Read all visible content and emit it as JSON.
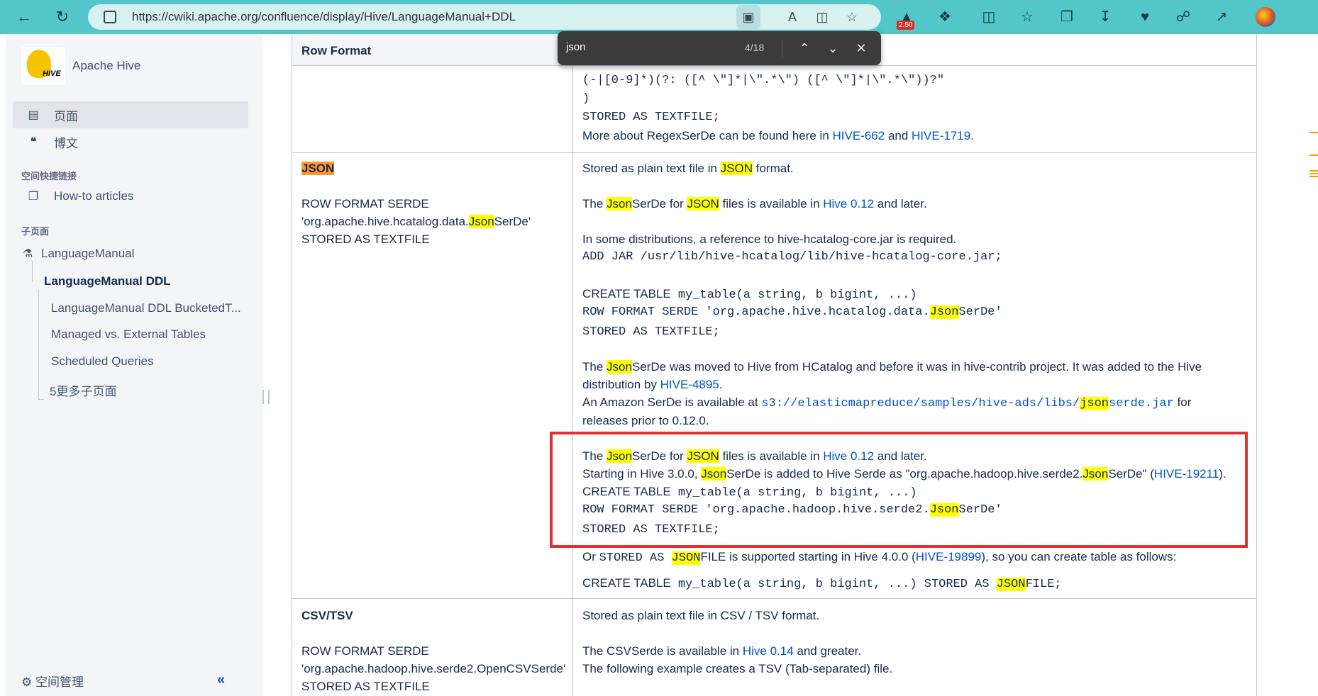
{
  "browser": {
    "url": "https://cwiki.apache.org/confluence/display/Hive/LanguageManual+DDL",
    "badge": "2.50",
    "find": {
      "query": "json",
      "count": "4/18"
    }
  },
  "sidebar": {
    "space_title": "Apache Hive",
    "logo_text": "HIVE",
    "items": [
      {
        "label": "页面",
        "icon": "page-icon"
      },
      {
        "label": "博文",
        "icon": "quote-icon"
      }
    ],
    "shortcuts_heading": "空间快捷链接",
    "shortcut": "How-to articles",
    "children_heading": "子页面",
    "tree": {
      "root": "LanguageManual",
      "current": "LanguageManual DDL",
      "children": [
        "LanguageManual DDL BucketedT...",
        "Managed vs. External Tables",
        "Scheduled Queries"
      ],
      "more": "5更多子页面"
    },
    "footer": "空间管理"
  },
  "table": {
    "header": "Row Format",
    "regex_row": {
      "code1": "(-|[0-9]*)(?: ([^ \\\"]*|\\\".*\\\") ([^ \\\"]*|\\\".*\\\"))?\"",
      "code2": ")",
      "code3": "STORED AS TEXTFILE;",
      "more_pre": "More about RegexSerDe can be found here in ",
      "link1": "HIVE-662",
      "and": " and ",
      "link2": "HIVE-1719",
      "end": "."
    },
    "json_row": {
      "label": "JSON",
      "serde1": "ROW FORMAT SERDE",
      "serde2_pre": "'org.apache.hive.hcatalog.data.",
      "serde2_hl": "Json",
      "serde2_post": "SerDe'",
      "serde3": "STORED AS TEXTFILE",
      "p1_pre": "Stored as plain text file in ",
      "p1_hl": "JSON",
      "p1_post": " format.",
      "p2_a": "The ",
      "p2_hl1": "Json",
      "p2_b": "SerDe for ",
      "p2_hl2": "JSON",
      "p2_c": " files is available in ",
      "p2_link": "Hive 0.12",
      "p2_d": " and later.",
      "p3": "In some distributions, a reference to hive-hcatalog-core.jar is required.",
      "p3_code": "ADD JAR /usr/lib/hive-hcatalog/lib/hive-hcatalog-core.jar;",
      "c1_kw": "CREATE TABLE",
      "c1_rest": " my_table(a string, b bigint, ...)",
      "c2_pre": "ROW FORMAT SERDE 'org.apache.hive.hcatalog.data.",
      "c2_hl": "Json",
      "c2_post": "SerDe'",
      "c3_kw": "STORED AS TEXTFILE",
      "c3_end": ";",
      "p4_a": "The ",
      "p4_hl": "Json",
      "p4_b": "SerDe was moved to Hive from HCatalog and before it was in hive-contrib project. It was added to the Hive",
      "p4_c": "distribution by ",
      "p4_link": "HIVE-4895",
      "p4_d": ".",
      "p5_a": "An Amazon SerDe is available at ",
      "p5_code_pre": "s3://elasticmapreduce/samples/hive-ads/libs/",
      "p5_code_hl": "json",
      "p5_code_post": "serde.jar",
      "p5_b": " for",
      "p6": "releases prior to 0.12.0.",
      "q1_a": "The ",
      "q1_hl1": "Json",
      "q1_b": "SerDe for ",
      "q1_hl2": "JSON",
      "q1_c": " files is available in ",
      "q1_link": "Hive 0.12",
      "q1_d": " and later.",
      "q2_a": "Starting in Hive 3.0.0, ",
      "q2_hl1": "Json",
      "q2_b": "SerDe is added to Hive Serde as \"org.apache.hadoop.hive.serde2.",
      "q2_hl2": "Json",
      "q2_c": "SerDe\" (",
      "q2_link": "HIVE-19211",
      "q2_d": ").",
      "q3_kw": "CREATE TABLE",
      "q3_rest": " my_table(a string, b bigint, ...)",
      "q4_pre": "ROW FORMAT SERDE 'org.apache.hadoop.hive.serde2.",
      "q4_hl": "Json",
      "q4_post": "SerDe'",
      "q5_kw": "STORED AS TEXTFILE",
      "q5_end": ";",
      "r1_a": "Or ",
      "r1_code": "STORED AS ",
      "r1_hl": "JSON",
      "r1_b": "FILE is supported starting in Hive 4.0.0 (",
      "r1_link": "HIVE-19899",
      "r1_c": "), so you can create table as follows:",
      "r2_kw": "CREATE TABLE",
      "r2_rest": " my_table(a string, b bigint, ...) STORED AS ",
      "r2_hl": "JSON",
      "r2_end": "FILE;"
    },
    "csv_row": {
      "label": "CSV/TSV",
      "serde1": "ROW FORMAT SERDE",
      "serde2": "'org.apache.hadoop.hive.serde2.OpenCSVSerde'",
      "serde3": "STORED AS TEXTFILE",
      "p1": "Stored as plain text file in CSV / TSV format.",
      "p2_pre": "The CSVSerde is available in ",
      "p2_link": "Hive 0.14",
      "p2_post": " and greater.",
      "p3": "The following example creates a TSV (Tab-separated) file."
    }
  }
}
